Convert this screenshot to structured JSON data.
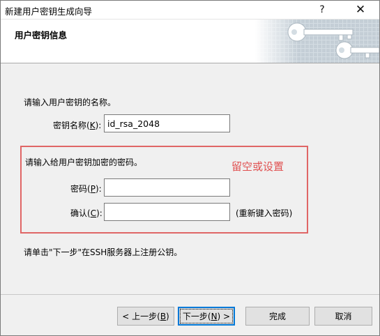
{
  "window": {
    "title": "新建用户密钥生成向导",
    "help_label": "?",
    "close_label": "✕"
  },
  "header": {
    "title": "用户密钥信息",
    "art_icon": "keys-icon"
  },
  "form": {
    "name_prompt": "请输入用户密钥的名称。",
    "key_name_label_pre": "密钥名称(",
    "key_name_label_key": "K",
    "key_name_label_post": "):",
    "key_name_value": "id_rsa_2048",
    "password_prompt": "请输入给用户密钥加密的密码。",
    "password_label_pre": "密码(",
    "password_label_key": "P",
    "password_label_post": "):",
    "password_value": "",
    "confirm_label_pre": "确认(",
    "confirm_label_key": "C",
    "confirm_label_post": "):",
    "confirm_value": "",
    "confirm_hint": "(重新键入密码)",
    "annotation": "留空或设置",
    "annotation_color": "#e05050",
    "footer_note": "请单击\"下一步\"在SSH服务器上注册公钥。"
  },
  "buttons": {
    "back_pre": "< 上一步(",
    "back_key": "B",
    "back_post": ")",
    "next_pre": "下一步(",
    "next_key": "N",
    "next_post": ") >",
    "finish": "完成",
    "cancel": "取消"
  }
}
